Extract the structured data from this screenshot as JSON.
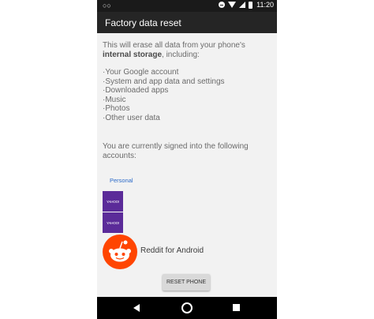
{
  "status_bar": {
    "voicemail_icon": "voicemail-icon",
    "icons": [
      "do-not-disturb-icon",
      "wifi-icon",
      "signal-icon",
      "battery-icon"
    ],
    "time": "11:20"
  },
  "app_bar": {
    "title": "Factory data reset"
  },
  "content": {
    "intro_line1": "This will erase all data from your phone's",
    "intro_bold": "internal storage",
    "intro_rest": ", including:",
    "erase_items": [
      "·Your Google account",
      "·System and app data and settings",
      "·Downloaded apps",
      "·Music",
      "·Photos",
      "·Other user data"
    ],
    "signed_in_line1": "You are currently signed into the following",
    "signed_in_line2": "accounts:",
    "accounts": [
      {
        "label": "Personal"
      },
      {
        "label": "YAHOO!"
      },
      {
        "label": "YAHOO!"
      },
      {
        "label": "Reddit for Android"
      }
    ],
    "reset_button": "RESET PHONE"
  },
  "nav_bar": {
    "icons": [
      "back-icon",
      "home-icon",
      "recents-icon"
    ]
  },
  "colors": {
    "status_bar": "#1a1a1a",
    "app_bar": "#252525",
    "content_bg": "#f2f2f2",
    "yahoo_purple": "#5b2b99",
    "reddit_orange": "#ff4500",
    "link_blue": "#2b6ac9",
    "button_bg": "#d9d9d9"
  }
}
